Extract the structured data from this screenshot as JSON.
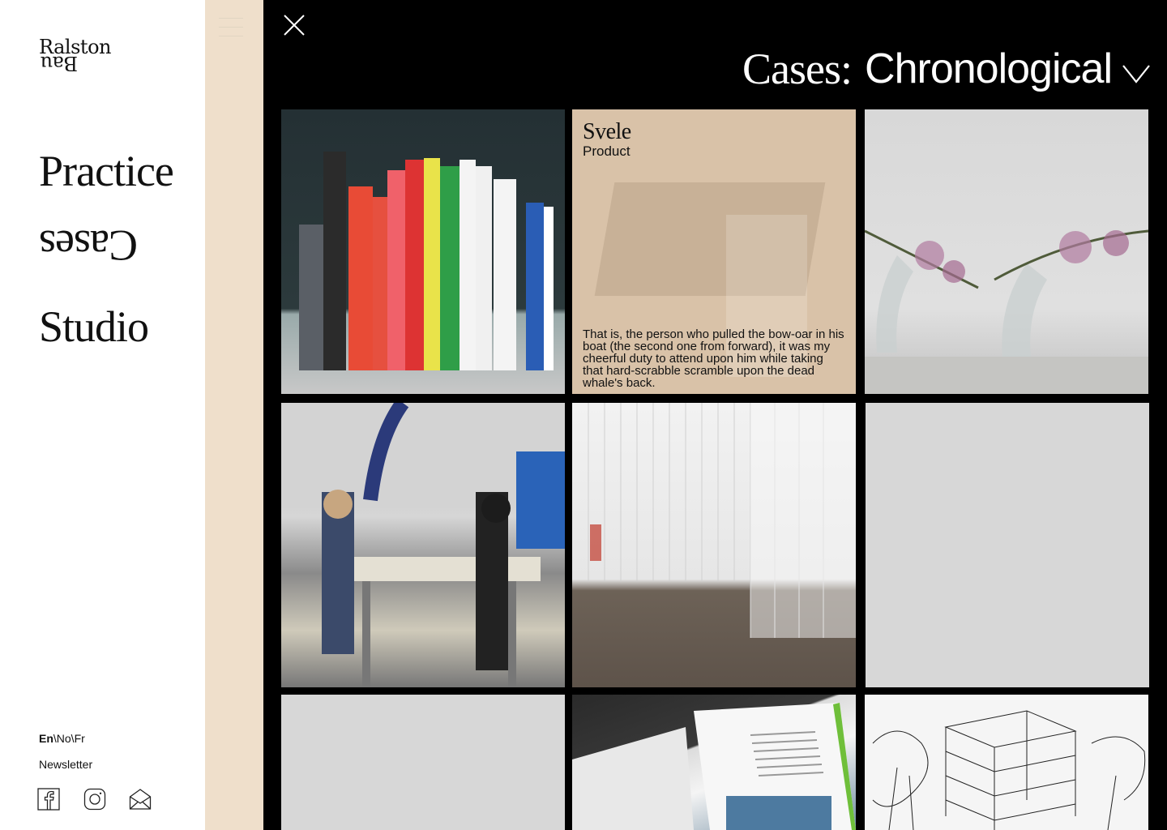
{
  "brand": {
    "line1": "Ralston",
    "line2": "Bau"
  },
  "nav": {
    "practice": "Practice",
    "cases": "Cases",
    "studio": "Studio"
  },
  "footer": {
    "lang_active": "En",
    "lang_rest": "\\No\\Fr",
    "newsletter": "Newsletter",
    "social": [
      "facebook-icon",
      "instagram-icon",
      "mail-icon"
    ]
  },
  "overlay": {
    "heading_prefix": "Cases:",
    "heading_value": "Chronological",
    "tiles": [
      {
        "kind": "image",
        "subject": "books"
      },
      {
        "kind": "hover",
        "title": "Svele",
        "category": "Product",
        "description": "That is, the person who pulled the bow-oar in his boat (the second one from forward), it was my cheerful duty to attend upon him while taking that hard-scrabble scramble upon the dead whale's back."
      },
      {
        "kind": "image",
        "subject": "flowers"
      },
      {
        "kind": "image",
        "subject": "workshop"
      },
      {
        "kind": "image",
        "subject": "facade"
      },
      {
        "kind": "placeholder"
      },
      {
        "kind": "placeholder"
      },
      {
        "kind": "image",
        "subject": "magazine"
      },
      {
        "kind": "image",
        "subject": "sketch"
      }
    ]
  },
  "colors": {
    "sidebar_bg": "#ffffff",
    "strip_bg": "#efdfcb",
    "overlay_bg": "#000000",
    "placeholder": "#d7d7d7",
    "hover_tint": "#d9c2a8"
  }
}
